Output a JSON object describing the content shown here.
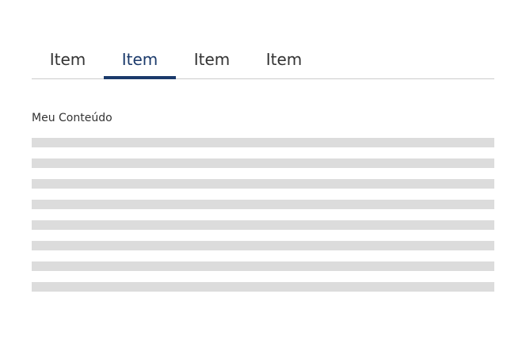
{
  "tabs": [
    {
      "label": "Item",
      "active": false
    },
    {
      "label": "Item",
      "active": true
    },
    {
      "label": "Item",
      "active": false
    },
    {
      "label": "Item",
      "active": false
    }
  ],
  "content": {
    "title": "Meu Conteúdo",
    "placeholder_line_count": 8
  },
  "colors": {
    "accent": "#1b3a6b",
    "placeholder": "#dcdcdc",
    "divider": "#cccccc"
  }
}
